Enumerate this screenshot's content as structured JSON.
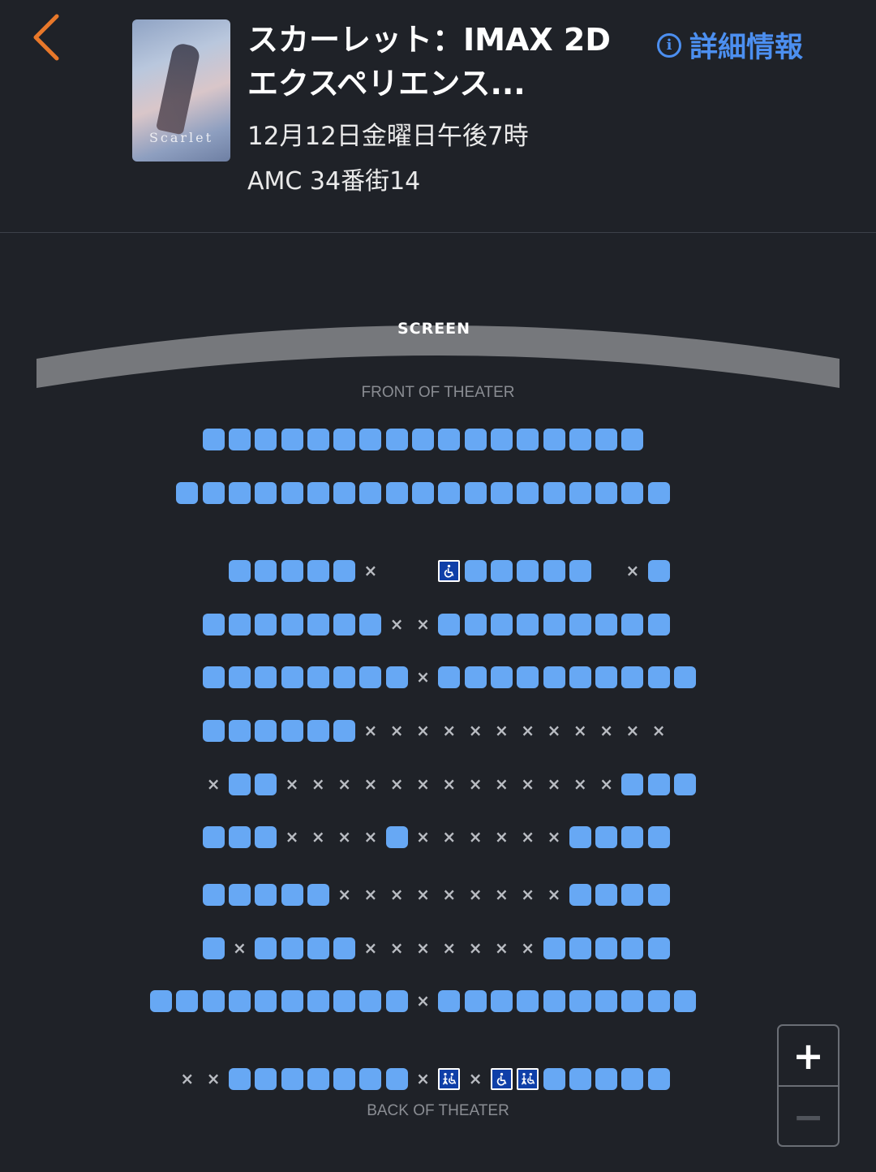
{
  "header": {
    "back_icon": "chevron-left-icon",
    "title_line1": "スカーレット：IMAX 2D",
    "title_line2": "エクスペリエンス...",
    "details_label": "詳細情報",
    "details_icon": "i",
    "showtime": "12月12日金曜日午後7時",
    "venue": "AMC 34番街14",
    "poster_text": "Scarlet"
  },
  "theater": {
    "screen_label": "SCREEN",
    "front_label": "FRONT OF THEATER",
    "back_label": "BACK OF THEATER",
    "legend": {
      "available": "o",
      "unavailable": "x",
      "wheelchair": "w",
      "companion": "c",
      "empty": "."
    },
    "rows": [
      "..ooooooooooooooooo..",
      ".ooooooooooooooooooo.",
      "...ooooox..wooooo.xo.",
      "..oooooooxxooooooooo.",
      "..ooooooooxoooooooooo",
      "..ooooooxxxxxxxxxxxx.",
      "..xooxxxxxxxxxxxxxooo",
      "..oooxxxxoxxxxxxoooo.",
      "..oooooxxxxxxxxxoooo.",
      "..oxooooxxxxxxxooooo.",
      "ooooooooooxoooooooooo",
      ".xxoooooooxcxwcooooo."
    ]
  },
  "colors": {
    "background": "#1f2228",
    "seat_available": "#67a8f4",
    "seat_accessible": "#0f3fa8",
    "accent_back": "#e8782a",
    "link": "#4c8ff0",
    "screen": "#76787c"
  },
  "zoom": {
    "in_label": "+",
    "out_label": "−"
  }
}
